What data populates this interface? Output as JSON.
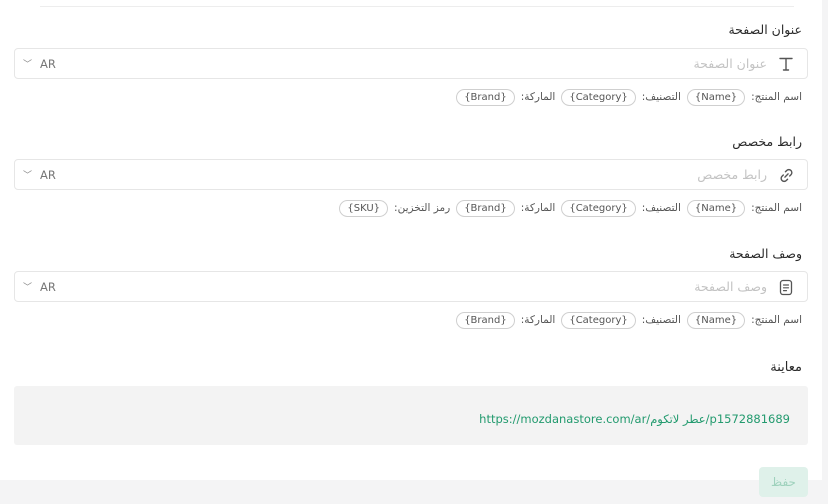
{
  "page_title": {
    "label": "عنوان الصفحة",
    "placeholder": "عنوان الصفحة",
    "lang": "AR",
    "vars": [
      {
        "label": "اسم المنتج:",
        "chip": "{Name}"
      },
      {
        "label": "التصنيف:",
        "chip": "{Category}"
      },
      {
        "label": "الماركة:",
        "chip": "{Brand}"
      }
    ]
  },
  "custom_link": {
    "label": "رابط مخصص",
    "placeholder": "رابط مخصص",
    "lang": "AR",
    "vars": [
      {
        "label": "اسم المنتج:",
        "chip": "{Name}"
      },
      {
        "label": "التصنيف:",
        "chip": "{Category}"
      },
      {
        "label": "الماركة:",
        "chip": "{Brand}"
      },
      {
        "label": "رمز التخزين:",
        "chip": "{SKU}"
      }
    ]
  },
  "page_description": {
    "label": "وصف الصفحة",
    "placeholder": "وصف الصفحة",
    "lang": "AR",
    "vars": [
      {
        "label": "اسم المنتج:",
        "chip": "{Name}"
      },
      {
        "label": "التصنيف:",
        "chip": "{Category}"
      },
      {
        "label": "الماركة:",
        "chip": "{Brand}"
      }
    ]
  },
  "preview": {
    "label": "معاينة",
    "url": "https://mozdanastore.com/ar/عطر لاتكوم/p1572881689"
  },
  "save_label": "حفظ",
  "colors": {
    "accent": "#229a6e",
    "save_bg": "#dff1ea"
  },
  "icons": {
    "title_field": "text-icon",
    "link_field": "link-icon",
    "description_field": "document-icon",
    "lang_dropdown": "chevron-down-icon"
  }
}
